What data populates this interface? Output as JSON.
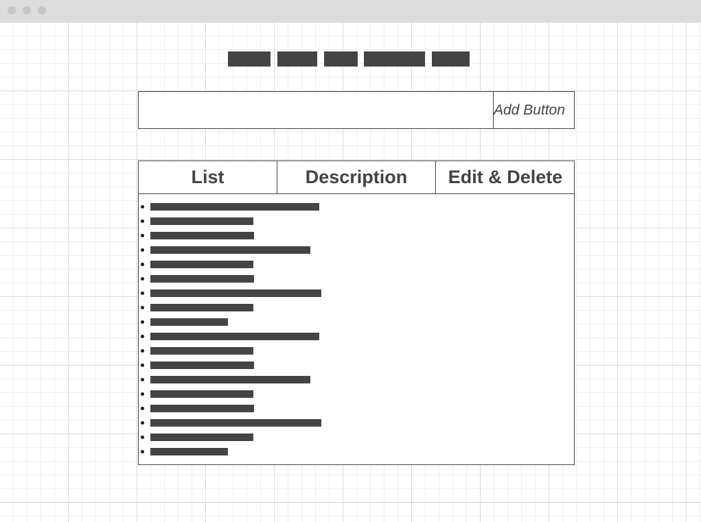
{
  "window": {
    "controls": [
      "close-dot",
      "minimize-dot",
      "maximize-dot"
    ]
  },
  "nav": {
    "items": [
      "nav-item-1",
      "nav-item-2",
      "nav-item-3",
      "nav-item-4",
      "nav-item-5"
    ]
  },
  "add": {
    "input_value": "",
    "button_label": "Add Button"
  },
  "table": {
    "headers": [
      "List",
      "Description",
      "Edit & Delete"
    ],
    "rows": 18
  },
  "colors": {
    "ink": "#444444",
    "titlebar": "#dcdcdc",
    "grid": "#d9d9d9"
  }
}
